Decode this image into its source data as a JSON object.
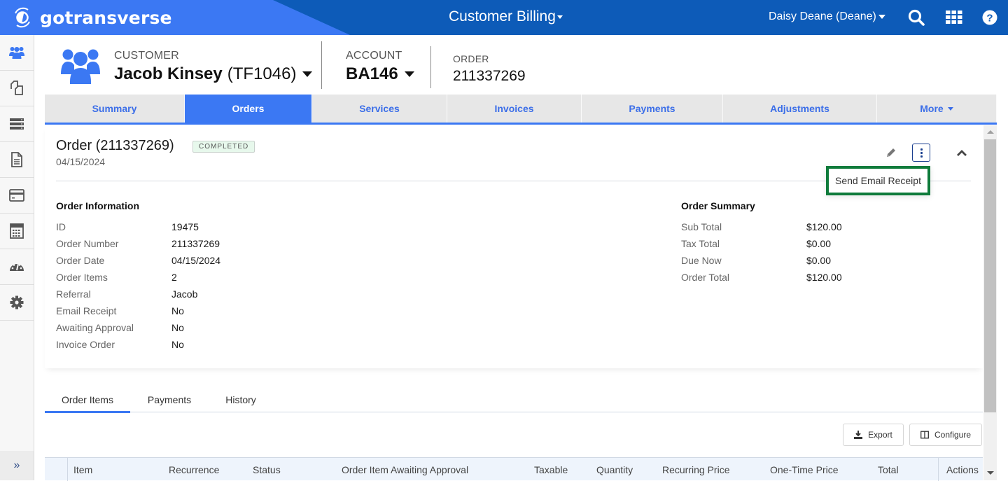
{
  "topbar": {
    "brand": "gotransverse",
    "app_switcher": "Customer Billing",
    "user": "Daisy Deane (Deane)",
    "icons": [
      "search-icon",
      "apps-grid-icon",
      "help-icon"
    ]
  },
  "sidebar": {
    "items": [
      {
        "name": "customers",
        "icon": "users-icon",
        "active": true
      },
      {
        "name": "catalog",
        "icon": "copy-icon"
      },
      {
        "name": "services",
        "icon": "server-icon"
      },
      {
        "name": "documents",
        "icon": "document-icon"
      },
      {
        "name": "payments",
        "icon": "credit-card-icon"
      },
      {
        "name": "calculator",
        "icon": "calculator-icon"
      },
      {
        "name": "dashboard",
        "icon": "speedometer-icon"
      },
      {
        "name": "settings",
        "icon": "gear-icon"
      }
    ],
    "expand_label": "»"
  },
  "context": {
    "customer_label": "CUSTOMER",
    "customer_name": "Jacob Kinsey",
    "customer_id": "(TF1046)",
    "account_label": "ACCOUNT",
    "account_value": "BA146",
    "order_label": "ORDER",
    "order_value": "211337269"
  },
  "main_tabs": [
    {
      "label": "Summary"
    },
    {
      "label": "Orders",
      "active": true
    },
    {
      "label": "Services"
    },
    {
      "label": "Invoices"
    },
    {
      "label": "Payments"
    },
    {
      "label": "Adjustments"
    },
    {
      "label": "More"
    }
  ],
  "order": {
    "title": "Order (211337269)",
    "status": "COMPLETED",
    "date": "04/15/2024",
    "menu_item": "Send Email Receipt",
    "info_heading": "Order Information",
    "info": [
      {
        "label": "ID",
        "value": "19475"
      },
      {
        "label": "Order Number",
        "value": "211337269"
      },
      {
        "label": "Order Date",
        "value": "04/15/2024"
      },
      {
        "label": "Order Items",
        "value": "2"
      },
      {
        "label": "Referral",
        "value": "Jacob"
      },
      {
        "label": "Email Receipt",
        "value": "No"
      },
      {
        "label": "Awaiting Approval",
        "value": "No"
      },
      {
        "label": "Invoice Order",
        "value": "No"
      }
    ],
    "summary_heading": "Order Summary",
    "summary": [
      {
        "label": "Sub Total",
        "value": "$120.00"
      },
      {
        "label": "Tax Total",
        "value": "$0.00"
      },
      {
        "label": "Due Now",
        "value": "$0.00"
      },
      {
        "label": "Order Total",
        "value": "$120.00"
      }
    ]
  },
  "sub_tabs": [
    {
      "label": "Order Items",
      "active": true
    },
    {
      "label": "Payments"
    },
    {
      "label": "History"
    }
  ],
  "toolbar": {
    "export_label": "Export",
    "configure_label": "Configure"
  },
  "table": {
    "columns": [
      "",
      "Item",
      "Recurrence",
      "Status",
      "Order Item Awaiting Approval",
      "Taxable",
      "Quantity",
      "Recurring Price",
      "One-Time Price",
      "Total",
      "Actions"
    ]
  },
  "colors": {
    "brand_blue": "#3b78f3",
    "topbar_dark": "#0d5bb8",
    "highlight_green": "#0f7b3b",
    "badge_bg": "#e7f8ec"
  }
}
